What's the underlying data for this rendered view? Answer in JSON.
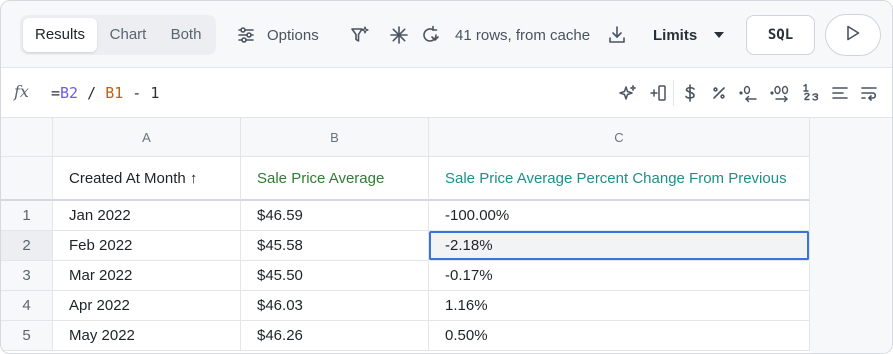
{
  "toolbar": {
    "tabs": [
      {
        "label": "Results",
        "active": true
      },
      {
        "label": "Chart",
        "active": false
      },
      {
        "label": "Both",
        "active": false
      }
    ],
    "options_label": "Options",
    "status_text": "41 rows, from cache",
    "limits_label": "Limits",
    "sql_label": "SQL",
    "icons": [
      "sliders-icon",
      "sparkle-filter-icon",
      "snowflake-icon",
      "refresh-icon",
      "download-icon",
      "chevron-down-icon",
      "play-icon"
    ]
  },
  "formula_bar": {
    "fx_label": "fx",
    "formula": {
      "prefix": "=",
      "ref1": "B2",
      "middle": " / ",
      "ref2": "B1",
      "suffix": " - 1"
    },
    "format_icons": [
      "ai-sparkle-icon",
      "insert-column-icon",
      "dollar-icon",
      "percent-icon",
      "decrease-decimals-icon",
      "increase-decimals-icon",
      "number-format-icon",
      "align-icon",
      "wrap-icon"
    ],
    "accent_colors": {
      "ref_b": "#6c5ce7",
      "ref_a": "#c0620c"
    }
  },
  "grid": {
    "column_letters": [
      "A",
      "B",
      "C"
    ],
    "headers": [
      {
        "label": "Created At Month ↑",
        "color": "#1f2328"
      },
      {
        "label": "Sale Price Average",
        "color": "#2e7d32"
      },
      {
        "label": "Sale Price Average Percent Change From Previous",
        "color": "#1f8f8a"
      }
    ],
    "rows": [
      {
        "num": "1",
        "cells": [
          "Jan 2022",
          "$46.59",
          "-100.00%"
        ]
      },
      {
        "num": "2",
        "cells": [
          "Feb 2022",
          "$45.58",
          "-2.18%"
        ]
      },
      {
        "num": "3",
        "cells": [
          "Mar 2022",
          "$45.50",
          "-0.17%"
        ]
      },
      {
        "num": "4",
        "cells": [
          "Apr 2022",
          "$46.03",
          "1.16%"
        ]
      },
      {
        "num": "5",
        "cells": [
          "May 2022",
          "$46.26",
          "0.50%"
        ]
      }
    ],
    "selected_cell": "C2",
    "selection_color": "#3b73d9"
  }
}
